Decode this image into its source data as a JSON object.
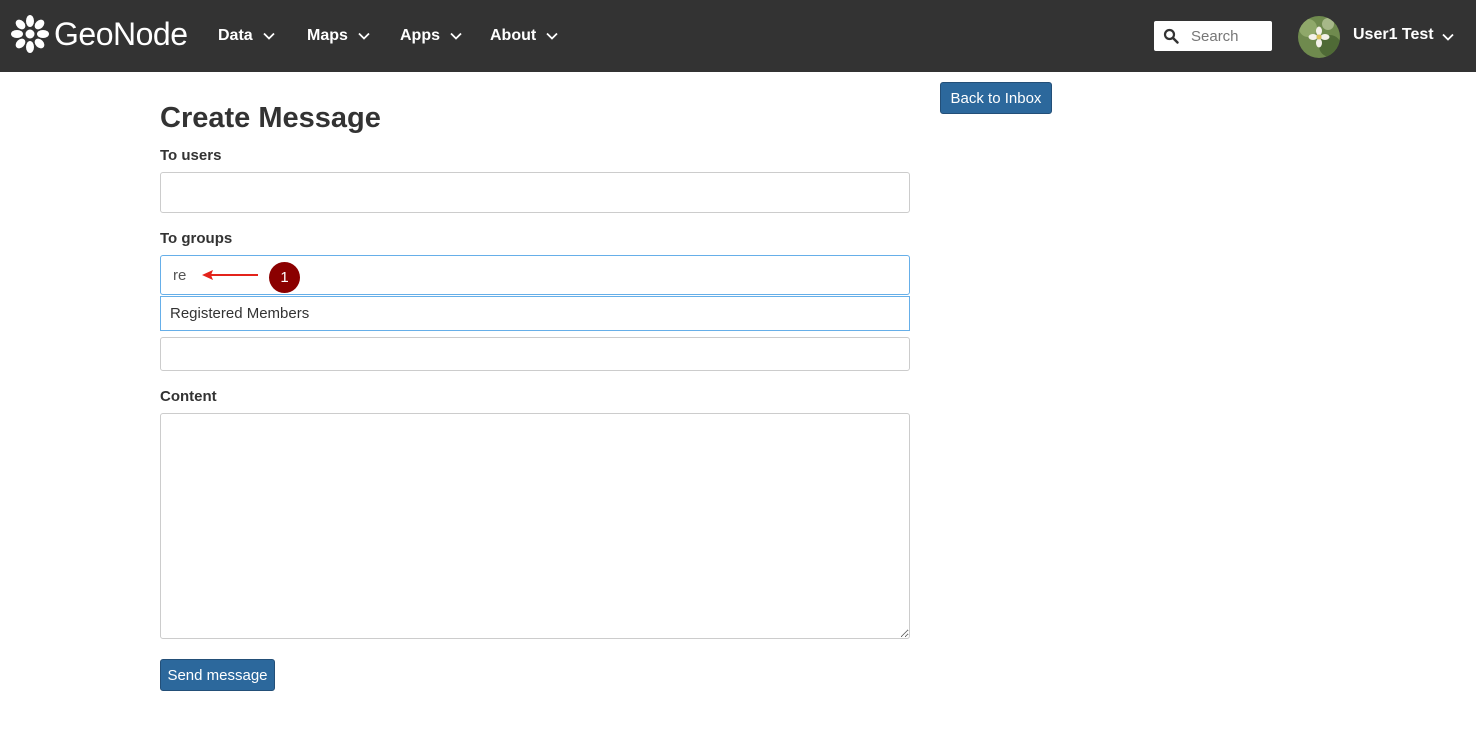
{
  "navbar": {
    "brand": "GeoNode",
    "items": [
      {
        "label": "Data"
      },
      {
        "label": "Maps"
      },
      {
        "label": "Apps"
      },
      {
        "label": "About"
      }
    ],
    "search_placeholder": "Search",
    "user_name": "User1 Test"
  },
  "page": {
    "title": "Create Message",
    "back_button": "Back to Inbox"
  },
  "form": {
    "to_users_label": "To users",
    "to_users_value": "",
    "to_groups_label": "To groups",
    "to_groups_value": "re",
    "autocomplete_option": "Registered Members",
    "subject_value": "",
    "content_label": "Content",
    "content_value": "",
    "send_button": "Send message"
  },
  "annotation": {
    "badge_number": "1",
    "color": "#8b0000"
  },
  "colors": {
    "navbar_bg": "#333333",
    "primary_button": "#2c689c",
    "focus_border": "#66afe9"
  }
}
